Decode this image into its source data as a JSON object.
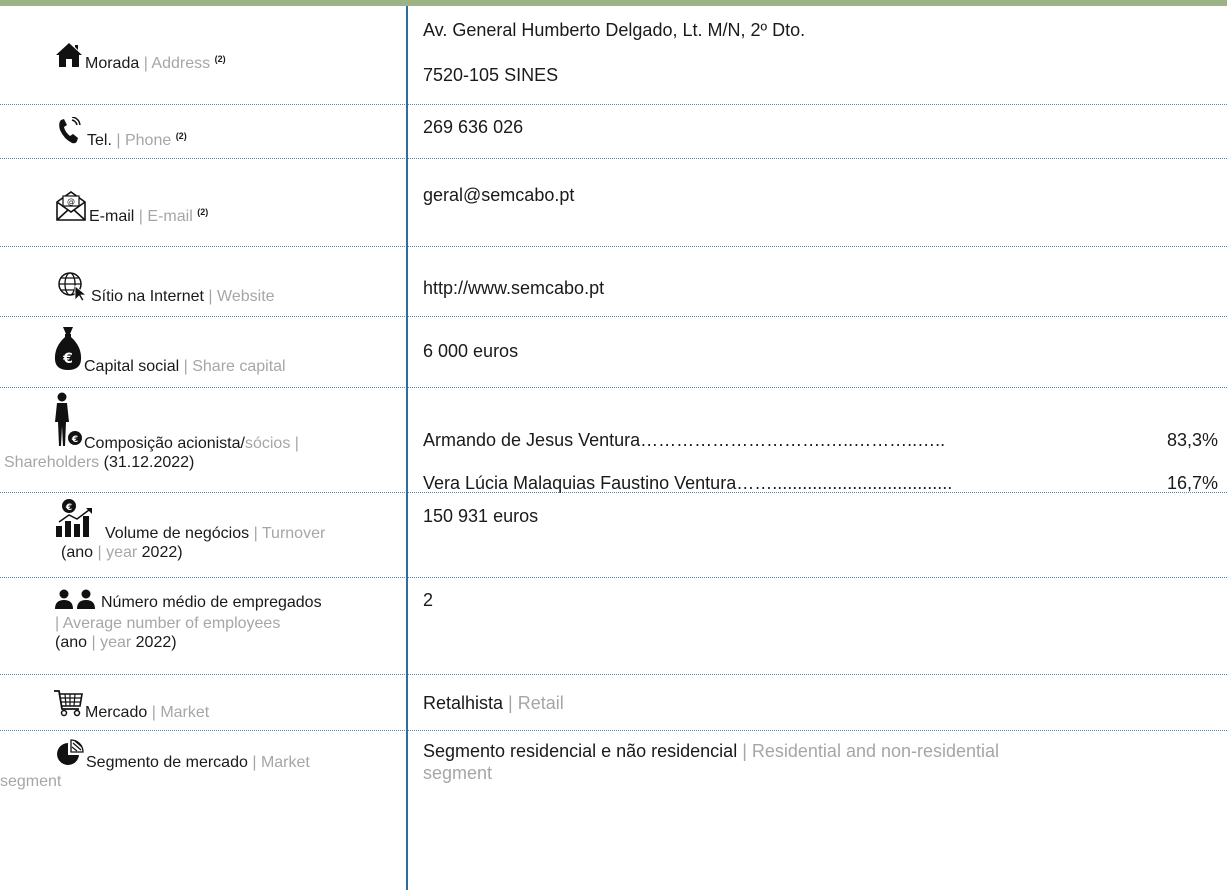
{
  "rows": {
    "address": {
      "label_pt": "Morada",
      "label_en": "Address",
      "sup": "(2)",
      "line1": "Av. General Humberto Delgado, Lt. M/N, 2º Dto.",
      "line2": "7520-105 SINES",
      "icon": "home-icon"
    },
    "phone": {
      "label_pt": "Tel.",
      "label_en": "Phone",
      "sup": "(2)",
      "value": "269 636 026",
      "icon": "phone-icon"
    },
    "email": {
      "label_pt": "E-mail",
      "label_en": "E-mail",
      "sup": "(2)",
      "value": "geral@semcabo.pt",
      "icon": "envelope-icon"
    },
    "website": {
      "label_pt": "Sítio na Internet",
      "label_en": "Website",
      "value": "http://www.semcabo.pt",
      "icon": "globe-cursor-icon"
    },
    "capital": {
      "label_pt": "Capital social",
      "label_en": "Share capital",
      "value": "6 000 euros",
      "icon": "money-bag-euro-icon"
    },
    "shareholders": {
      "label_pt": "Composição acionista/",
      "label_pt_gray": "sócios",
      "label_en": "Shareholders",
      "label_date": "(31.12.2022)",
      "holders": [
        {
          "name": "Armando de Jesus Ventura",
          "dots": "………………………….…..………..…..",
          "pct": "83,3%"
        },
        {
          "name": "Vera Lúcia Malaquias Faustino Ventura",
          "dots": "……....................................",
          "pct": "16,7%"
        }
      ],
      "icon": "person-money-icon"
    },
    "turnover": {
      "label_pt": "Volume de negócios",
      "label_en": "Turnover",
      "year_pt": "(ano",
      "year_en": "year",
      "year_val": "2022)",
      "value": "150 931 euros",
      "icon": "bar-chart-euro-icon"
    },
    "employees": {
      "label_pt": "Número médio de empregados",
      "label_en": "Average number of employees",
      "year_pt": "(ano",
      "year_en": "year",
      "year_val": "2022)",
      "value": "2",
      "icon": "two-people-icon"
    },
    "market": {
      "label_pt": "Mercado",
      "label_en": "Market",
      "value_pt": "Retalhista",
      "value_en": "Retail",
      "icon": "shopping-cart-icon"
    },
    "segment": {
      "label_pt": "Segmento de mercado",
      "label_en": "Market",
      "label_en2": "segment",
      "value_pt": "Segmento residencial e não residencial",
      "value_en": "Residential and non-residential",
      "value_en2": "segment",
      "icon": "pie-chart-icon"
    }
  },
  "colors": {
    "top_bar": "#9cb386",
    "divider": "#2e6e9e",
    "row_border": "#4a86b8",
    "secondary_text": "#a6a6a6"
  }
}
